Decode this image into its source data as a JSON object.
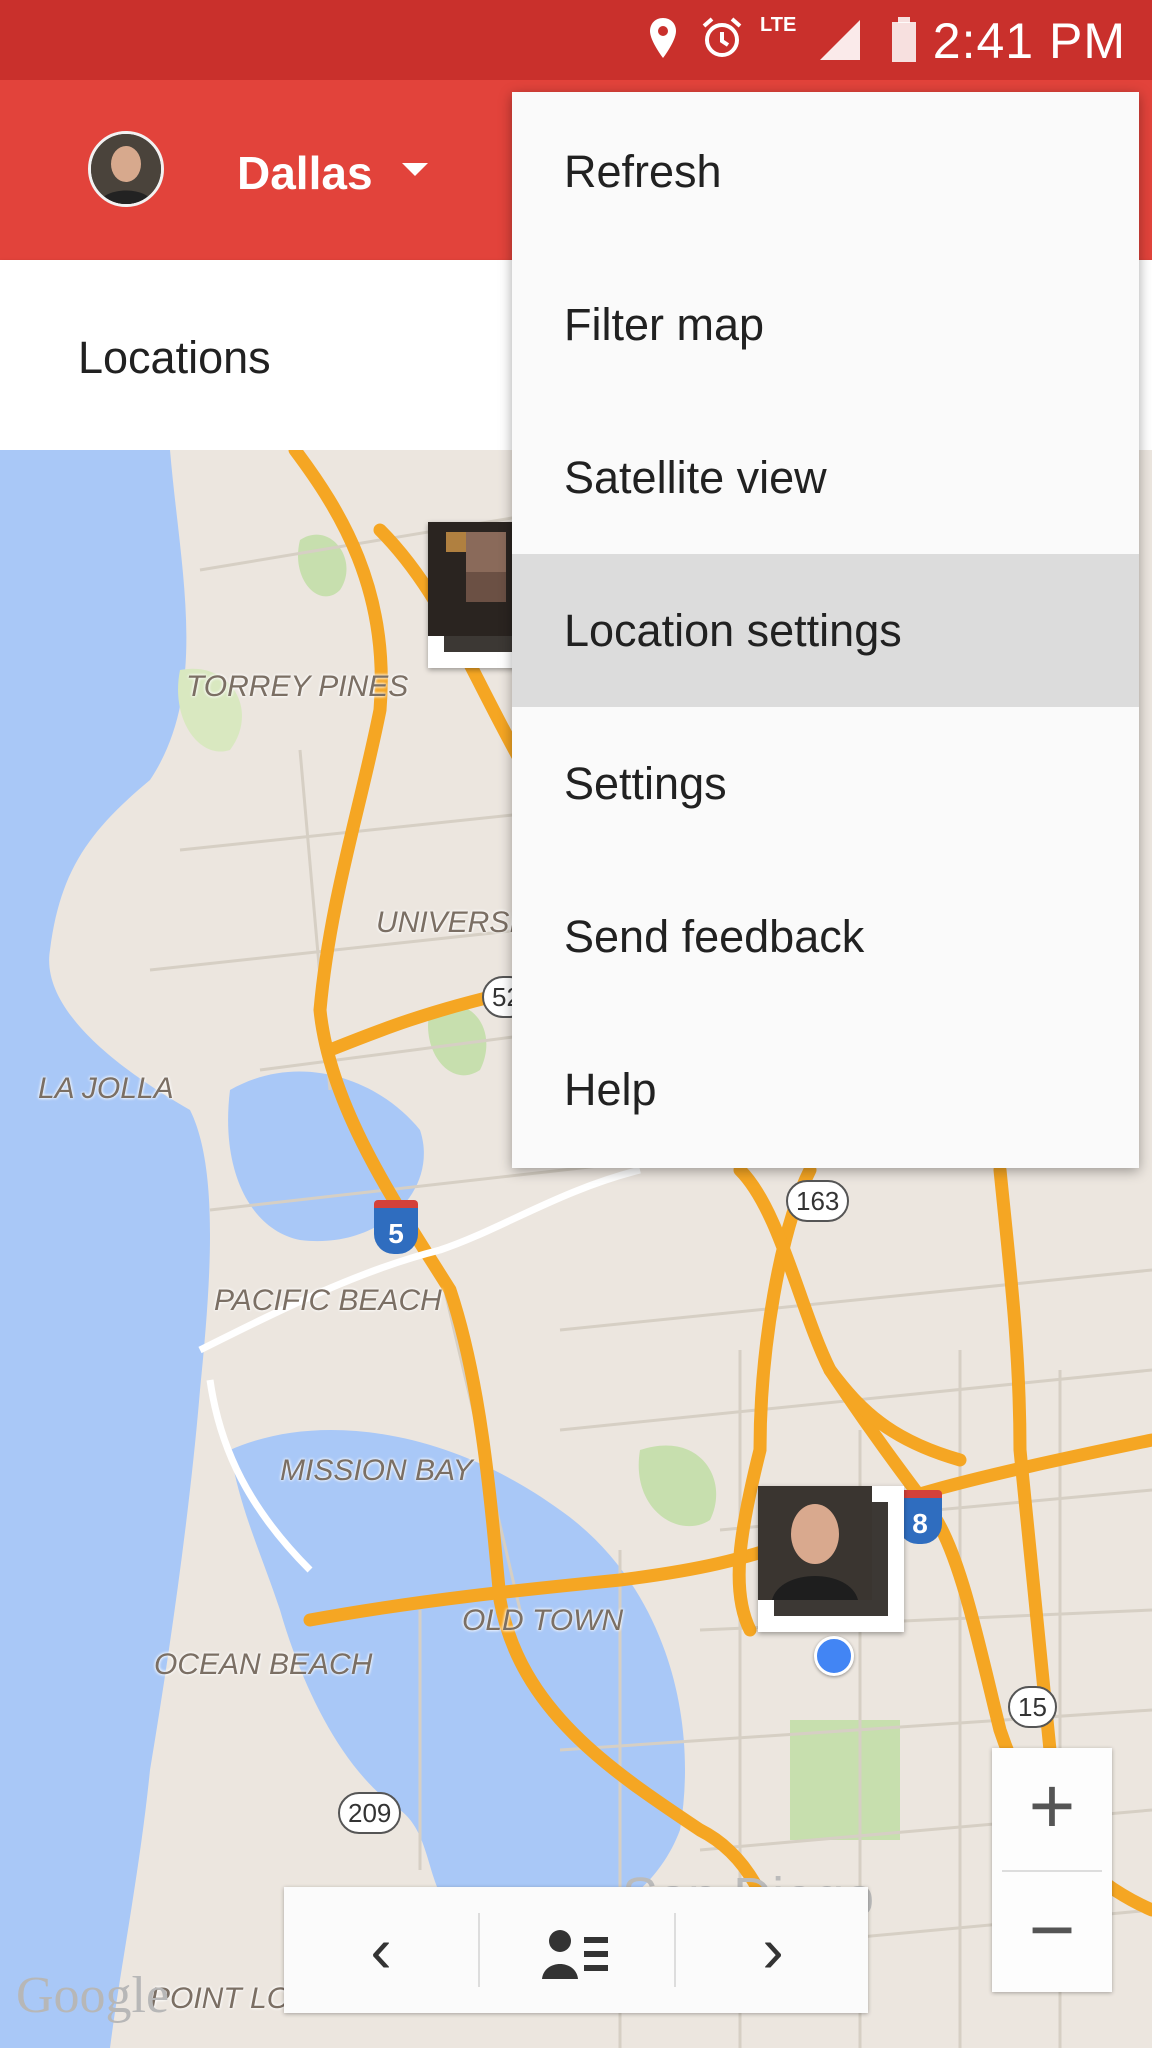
{
  "status_bar": {
    "time": "2:41 PM",
    "network": "LTE",
    "icons": [
      "location-icon",
      "alarm-icon",
      "lte-icon",
      "signal-icon",
      "battery-icon"
    ]
  },
  "app_bar": {
    "account_name": "Dallas",
    "avatar": "user-avatar",
    "colors": {
      "status_bar": "#c9302c",
      "app_bar": "#e2433b"
    }
  },
  "sub_header": {
    "title": "Locations"
  },
  "overflow_menu": {
    "items": [
      {
        "label": "Refresh"
      },
      {
        "label": "Filter map"
      },
      {
        "label": "Satellite view"
      },
      {
        "label": "Location settings",
        "highlighted": true
      },
      {
        "label": "Settings"
      },
      {
        "label": "Send feedback"
      },
      {
        "label": "Help"
      }
    ]
  },
  "map": {
    "labels": {
      "torrey_pines": "TORREY PINES",
      "university": "UNIVERSIT",
      "la_jolla": "LA JOLLA",
      "pacific_beach": "PACIFIC BEACH",
      "mission_bay": "MISSION BAY",
      "old_town": "OLD TOWN",
      "ocean_beach": "OCEAN BEACH",
      "point_loma": "POINT LOMA",
      "san_diego": "San Diego"
    },
    "route_shields": {
      "i5": "5",
      "r52": "52",
      "r163": "163",
      "r15": "15",
      "r209": "209",
      "i8": "8"
    },
    "attribution": "Google"
  },
  "controls": {
    "zoom_in": "+",
    "zoom_out": "−",
    "prev": "‹",
    "next": "›",
    "list_icon": "person-list-icon"
  }
}
